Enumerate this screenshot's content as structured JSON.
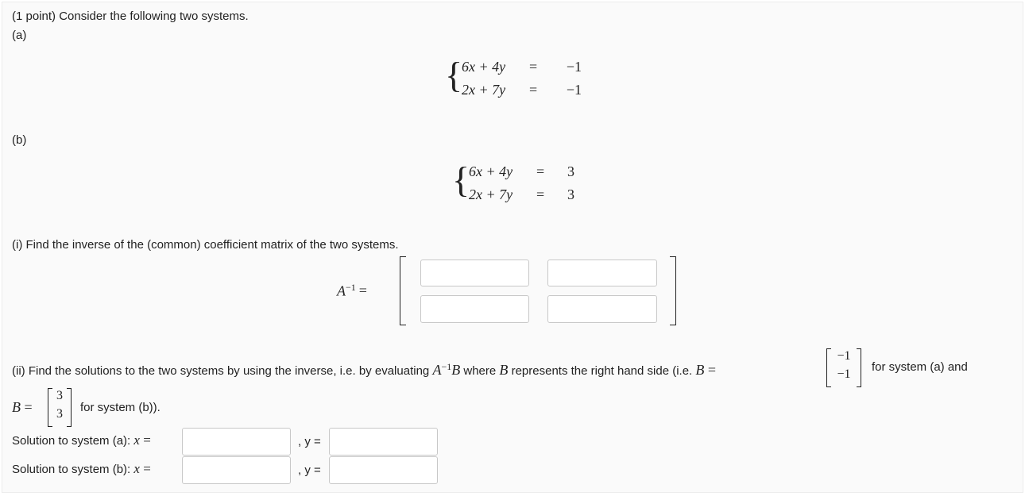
{
  "header": {
    "intro": "(1 point) Consider the following two systems.",
    "part_a": "(a)",
    "part_b": "(b)"
  },
  "system_a": {
    "eq1_lhs": "6x + 4y",
    "eq1_rhs": "−1",
    "eq2_lhs": "2x + 7y",
    "eq2_rhs": "−1",
    "equals": "="
  },
  "system_b": {
    "eq1_lhs": "6x + 4y",
    "eq1_rhs": "3",
    "eq2_lhs": "2x + 7y",
    "eq2_rhs": "3",
    "equals": "="
  },
  "part_i": {
    "prompt": "(i) Find the inverse of the (common) coefficient matrix of the two systems.",
    "label": "A",
    "sup": "−1",
    "equals": "=",
    "inputs": [
      "",
      "",
      "",
      ""
    ]
  },
  "part_ii": {
    "prompt_start": "(ii) Find the solutions to the two systems by using the inverse, i.e. by evaluating ",
    "A": "A",
    "sup": "−1",
    "B": "B",
    "prompt_mid": " where ",
    "B2": "B",
    "prompt_mid2": " represents the right hand side (i.e. ",
    "B3": "B",
    "eq": " =",
    "vec_a": [
      "−1",
      "−1"
    ],
    "prompt_end": "for system (a) and",
    "B4": "B",
    "eq2": " =",
    "vec_b": [
      "3",
      "3"
    ],
    "for_b": "for system (b))."
  },
  "solutions": {
    "a_label": "Solution to system (a): ",
    "b_label": "Solution to system (b): ",
    "x": "x",
    "y": "y",
    "eq": " =",
    "comma_y": ", y =",
    "a_x": "",
    "a_y": "",
    "b_x": "",
    "b_y": ""
  }
}
